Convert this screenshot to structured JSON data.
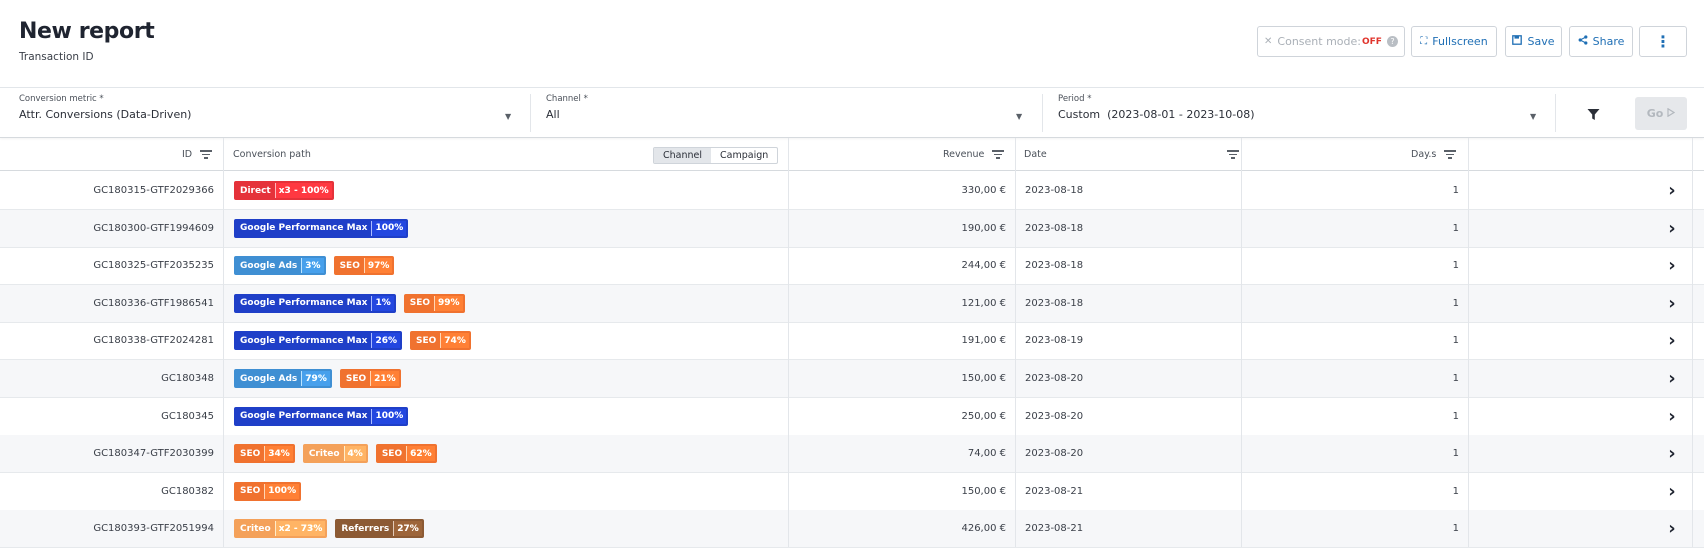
{
  "header": {
    "title": "New report",
    "subtitle": "Transaction ID",
    "consent_label": "Consent mode:",
    "consent_state": "OFF",
    "fullscreen_label": "Fullscreen",
    "save_label": "Save",
    "share_label": "Share",
    "more_label": "⋮"
  },
  "filters": {
    "metric": {
      "label": "Conversion metric *",
      "value": "Attr. Conversions (Data-Driven)"
    },
    "channel": {
      "label": "Channel *",
      "value": "All"
    },
    "period": {
      "label": "Period *",
      "value": "Custom  (2023-08-01 - 2023-10-08)"
    },
    "go_label": "Go"
  },
  "table": {
    "headers": {
      "id": "ID",
      "path": "Conversion path",
      "revenue": "Revenue",
      "date": "Date",
      "days": "Day.s"
    },
    "path_toggle": [
      "Channel",
      "Campaign"
    ],
    "channel_colors": {
      "Direct": "#e5323a",
      "Google Performance Max": "#1f3fc8",
      "Google Ads": "#3f8fd3",
      "SEO": "#f0722f",
      "Criteo": "#f4a15a",
      "Referrers": "#8c5a34"
    },
    "rows": [
      {
        "id": "GC180315-GTF2029366",
        "path": [
          {
            "channel": "Direct",
            "share": "x3 - 100%"
          }
        ],
        "revenue": "330,00 €",
        "date": "2023-08-18",
        "days": "1"
      },
      {
        "id": "GC180300-GTF1994609",
        "path": [
          {
            "channel": "Google Performance Max",
            "share": "100%"
          }
        ],
        "revenue": "190,00 €",
        "date": "2023-08-18",
        "days": "1"
      },
      {
        "id": "GC180325-GTF2035235",
        "path": [
          {
            "channel": "Google Ads",
            "share": "3%"
          },
          {
            "channel": "SEO",
            "share": "97%"
          }
        ],
        "revenue": "244,00 €",
        "date": "2023-08-18",
        "days": "1"
      },
      {
        "id": "GC180336-GTF1986541",
        "path": [
          {
            "channel": "Google Performance Max",
            "share": "1%"
          },
          {
            "channel": "SEO",
            "share": "99%"
          }
        ],
        "revenue": "121,00 €",
        "date": "2023-08-18",
        "days": "1"
      },
      {
        "id": "GC180338-GTF2024281",
        "path": [
          {
            "channel": "Google Performance Max",
            "share": "26%"
          },
          {
            "channel": "SEO",
            "share": "74%"
          }
        ],
        "revenue": "191,00 €",
        "date": "2023-08-19",
        "days": "1"
      },
      {
        "id": "GC180348",
        "path": [
          {
            "channel": "Google Ads",
            "share": "79%"
          },
          {
            "channel": "SEO",
            "share": "21%"
          }
        ],
        "revenue": "150,00 €",
        "date": "2023-08-20",
        "days": "1"
      },
      {
        "id": "GC180345",
        "path": [
          {
            "channel": "Google Performance Max",
            "share": "100%"
          }
        ],
        "revenue": "250,00 €",
        "date": "2023-08-20",
        "days": "1"
      },
      {
        "id": "GC180347-GTF2030399",
        "path": [
          {
            "channel": "SEO",
            "share": "34%"
          },
          {
            "channel": "Criteo",
            "share": "4%"
          },
          {
            "channel": "SEO",
            "share": "62%"
          }
        ],
        "revenue": "74,00 €",
        "date": "2023-08-20",
        "days": "1"
      },
      {
        "id": "GC180382",
        "path": [
          {
            "channel": "SEO",
            "share": "100%"
          }
        ],
        "revenue": "150,00 €",
        "date": "2023-08-21",
        "days": "1"
      },
      {
        "id": "GC180393-GTF2051994",
        "path": [
          {
            "channel": "Criteo",
            "share": "x2 - 73%"
          },
          {
            "channel": "Referrers",
            "share": "27%"
          }
        ],
        "revenue": "426,00 €",
        "date": "2023-08-21",
        "days": "1"
      }
    ]
  }
}
